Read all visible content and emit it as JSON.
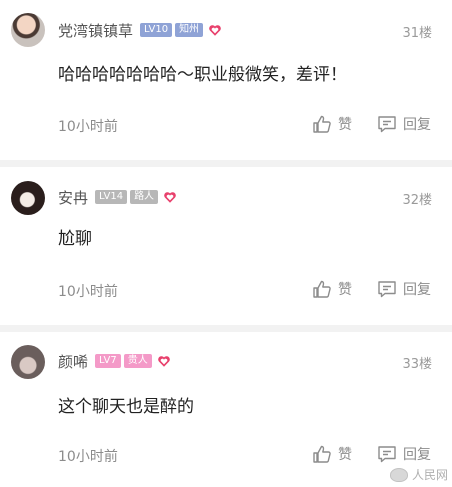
{
  "colors": {
    "level_badge": "#8fa3d6",
    "region_badge": "#8fa3d6",
    "guest_badge": "#b7b7b7",
    "vip_badge": "#f49ac8",
    "heart": "#e8406c"
  },
  "comments": [
    {
      "username": "党湾镇镇草",
      "level": "LV10",
      "tag": "知州",
      "floor": "31楼",
      "content": "哈哈哈哈哈哈哈～职业般微笑，差评！",
      "time": "10小时前",
      "like_label": "赞",
      "reply_label": "回复"
    },
    {
      "username": "安冉",
      "level": "LV14",
      "tag": "路人",
      "floor": "32楼",
      "content": "尬聊",
      "time": "10小时前",
      "like_label": "赞",
      "reply_label": "回复"
    },
    {
      "username": "颜唏",
      "level": "LV7",
      "tag": "贵人",
      "floor": "33楼",
      "content": "这个聊天也是醉的",
      "time": "10小时前",
      "like_label": "赞",
      "reply_label": "回复"
    }
  ],
  "watermark": {
    "text": "人民网",
    "icon": "weibo-icon"
  }
}
